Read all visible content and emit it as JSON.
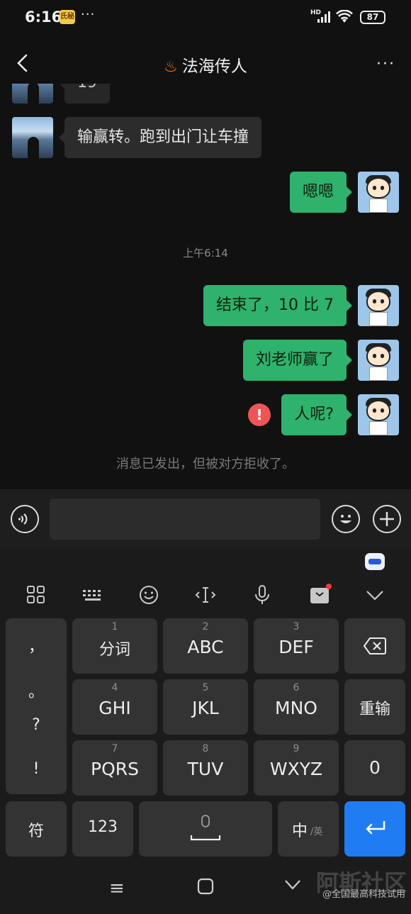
{
  "status_bar": {
    "time": "6:16",
    "app_badge": "氏秘",
    "more_dots": "···",
    "network": "HD",
    "battery": "87"
  },
  "header": {
    "title": "法海传人",
    "title_icon": "fire-icon",
    "more": "···"
  },
  "messages": [
    {
      "side": "in",
      "text": "19",
      "partial": true
    },
    {
      "side": "in",
      "text": "输赢转。跑到出门让车撞"
    },
    {
      "side": "out",
      "text": "嗯嗯"
    },
    {
      "side": "out",
      "text": "结束了，10 比 7"
    },
    {
      "side": "out",
      "text": "刘老师赢了"
    },
    {
      "side": "out",
      "text": "人呢?",
      "failed": true,
      "error_mark": "!"
    }
  ],
  "timestamp": "上午6:14",
  "system_note": "消息已发出，但被对方拒收了。",
  "input": {
    "placeholder": ""
  },
  "keyboard": {
    "toolbar": [
      "menu-grid-icon",
      "keyboard-icon",
      "emoji-icon",
      "cursor-icon",
      "mic-icon",
      "clipboard-icon",
      "collapse-icon"
    ],
    "punctuation": [
      "，",
      "。",
      "?",
      "!"
    ],
    "keys": [
      {
        "num": "1",
        "label": "分词"
      },
      {
        "num": "2",
        "label": "ABC"
      },
      {
        "num": "3",
        "label": "DEF"
      },
      {
        "num": "4",
        "label": "GHI"
      },
      {
        "num": "5",
        "label": "JKL"
      },
      {
        "num": "6",
        "label": "MNO"
      },
      {
        "num": "7",
        "label": "PQRS"
      },
      {
        "num": "8",
        "label": "TUV"
      },
      {
        "num": "9",
        "label": "WXYZ"
      }
    ],
    "side_keys": {
      "delete": "⌫",
      "retype": "重输",
      "zero": "0"
    },
    "bottom_row": {
      "symbols": "符",
      "numbers": "123",
      "lang_main": "中",
      "lang_sub": "/英",
      "enter": "↵"
    }
  },
  "watermark": {
    "big": "阿斯社区",
    "small": "@全国最高科技试用"
  }
}
